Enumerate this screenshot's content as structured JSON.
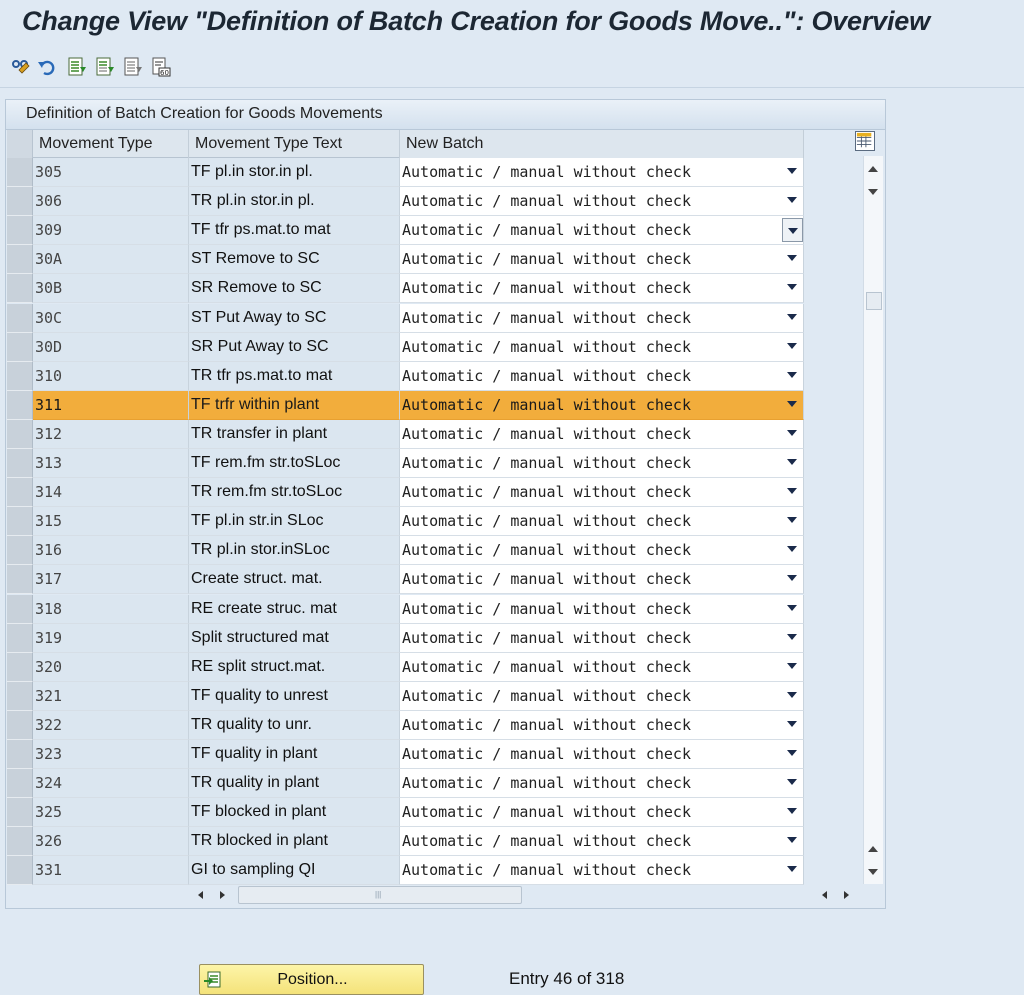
{
  "window": {
    "title": "Change View \"Definition of Batch Creation for Goods Move..\": Overview"
  },
  "toolbar": {
    "icons": [
      "display-change-icon",
      "undo-icon",
      "select-all-icon",
      "select-block-icon",
      "deselect-all-icon",
      "print-icon"
    ]
  },
  "panel": {
    "title": "Definition of Batch Creation for Goods Movements"
  },
  "table": {
    "columns": [
      "Movement Type",
      "Movement Type Text",
      "New Batch"
    ],
    "highlight_color": "#f2ad3c",
    "rows": [
      {
        "mt": "305",
        "text": "TF pl.in stor.in pl.",
        "new_batch": "Automatic / manual without check"
      },
      {
        "mt": "306",
        "text": "TR pl.in stor.in pl.",
        "new_batch": "Automatic / manual without check"
      },
      {
        "mt": "309",
        "text": "TF tfr ps.mat.to mat",
        "new_batch": "Automatic / manual without check"
      },
      {
        "mt": "30A",
        "text": "ST Remove to SC",
        "new_batch": "Automatic / manual without check"
      },
      {
        "mt": "30B",
        "text": "SR Remove to SC",
        "new_batch": "Automatic / manual without check"
      },
      {
        "mt": "30C",
        "text": "ST Put Away to SC",
        "new_batch": "Automatic / manual without check"
      },
      {
        "mt": "30D",
        "text": "SR Put Away to SC",
        "new_batch": "Automatic / manual without check"
      },
      {
        "mt": "310",
        "text": "TR tfr ps.mat.to mat",
        "new_batch": "Automatic / manual without check"
      },
      {
        "mt": "311",
        "text": "TF trfr within plant",
        "new_batch": "Automatic / manual without check"
      },
      {
        "mt": "312",
        "text": "TR transfer in plant",
        "new_batch": "Automatic / manual without check"
      },
      {
        "mt": "313",
        "text": "TF rem.fm str.toSLoc",
        "new_batch": "Automatic / manual without check"
      },
      {
        "mt": "314",
        "text": "TR rem.fm str.toSLoc",
        "new_batch": "Automatic / manual without check"
      },
      {
        "mt": "315",
        "text": "TF pl.in str.in SLoc",
        "new_batch": "Automatic / manual without check"
      },
      {
        "mt": "316",
        "text": "TR pl.in stor.inSLoc",
        "new_batch": "Automatic / manual without check"
      },
      {
        "mt": "317",
        "text": "Create struct. mat.",
        "new_batch": "Automatic / manual without check"
      },
      {
        "mt": "318",
        "text": "RE create struc. mat",
        "new_batch": "Automatic / manual without check"
      },
      {
        "mt": "319",
        "text": "Split structured mat",
        "new_batch": "Automatic / manual without check"
      },
      {
        "mt": "320",
        "text": "RE split struct.mat.",
        "new_batch": "Automatic / manual without check"
      },
      {
        "mt": "321",
        "text": "TF quality to unrest",
        "new_batch": "Automatic / manual without check"
      },
      {
        "mt": "322",
        "text": "TR quality to unr.",
        "new_batch": "Automatic / manual without check"
      },
      {
        "mt": "323",
        "text": "TF quality in plant",
        "new_batch": "Automatic / manual without check"
      },
      {
        "mt": "324",
        "text": "TR quality in plant",
        "new_batch": "Automatic / manual without check"
      },
      {
        "mt": "325",
        "text": "TF blocked in plant",
        "new_batch": "Automatic / manual without check"
      },
      {
        "mt": "326",
        "text": "TR blocked in plant",
        "new_batch": "Automatic / manual without check"
      },
      {
        "mt": "331",
        "text": "GI to sampling QI",
        "new_batch": "Automatic / manual without check"
      }
    ]
  },
  "footer": {
    "position_label": "Position...",
    "entry_text": "Entry 46 of 318"
  }
}
